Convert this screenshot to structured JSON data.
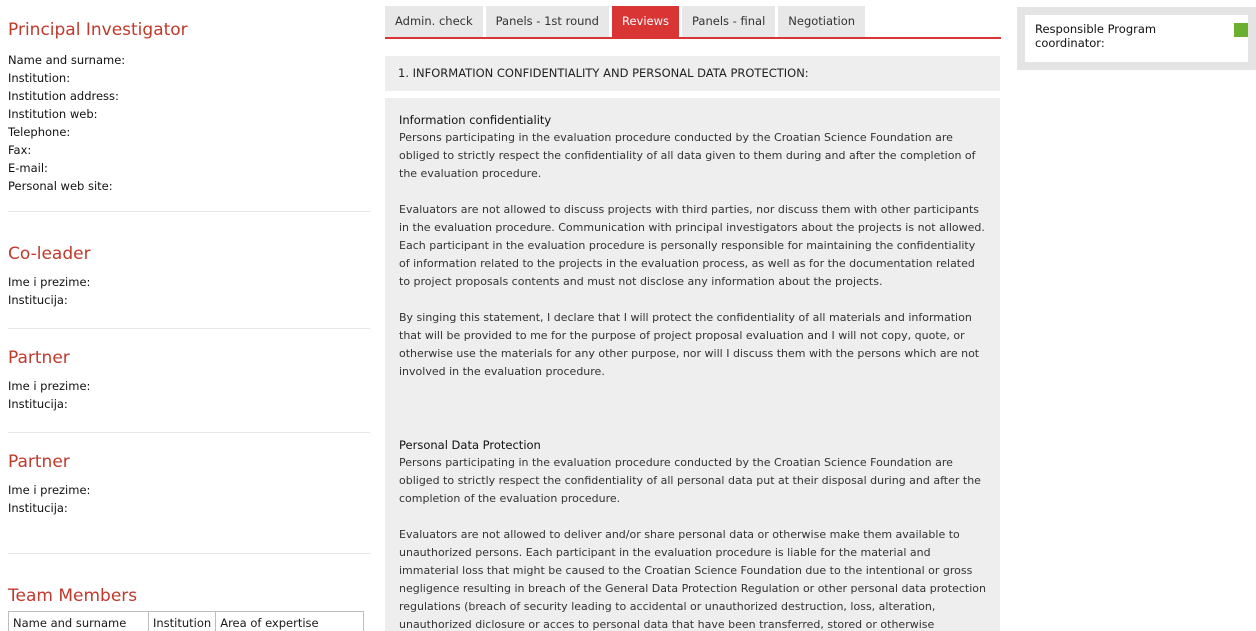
{
  "principal_investigator": {
    "title": "Principal Investigator",
    "fields": [
      "Name and surname:",
      "Institution:",
      "Institution address:",
      "Institution web:",
      "Telephone:",
      "Fax:",
      "E-mail:",
      "Personal web site:"
    ]
  },
  "co_leader": {
    "title": "Co-leader",
    "fields": [
      "Ime i prezime:",
      "Institucija:"
    ]
  },
  "partner1": {
    "title": "Partner",
    "fields": [
      "Ime i prezime:",
      "Institucija:"
    ]
  },
  "partner2": {
    "title": "Partner",
    "fields": [
      "Ime i prezime:",
      "Institucija:"
    ]
  },
  "team_members": {
    "title": "Team Members",
    "columns": [
      "Name and surname",
      "Institution",
      "Area of expertise"
    ]
  },
  "tabs": [
    {
      "label": "Admin. check",
      "active": false
    },
    {
      "label": "Panels - 1st round",
      "active": false
    },
    {
      "label": "Reviews",
      "active": true
    },
    {
      "label": "Panels - final",
      "active": false
    },
    {
      "label": "Negotiation",
      "active": false
    }
  ],
  "section": {
    "header": "1. INFORMATION CONFIDENTIALITY AND PERSONAL DATA PROTECTION:",
    "confidentiality": {
      "title": "Information confidentiality",
      "paragraphs": [
        "Persons participating in the evaluation procedure conducted by the Croatian Science Foundation are obliged to strictly respect the confidentiality of all data given to them during and after the completion of the evaluation procedure.",
        "Evaluators are not allowed to discuss projects with third parties, nor discuss them with other participants in the evaluation procedure. Communication with principal investigators about the projects is not allowed. Each participant in the evaluation procedure is personally responsible for maintaining the confidentiality of information related to the projects in the evaluation process, as well as for the documentation related to project proposals contents and must not disclose any information about the projects.",
        "By singing this statement, I declare that I will protect the confidentiality of all materials and information that will be provided to me for the purpose of project proposal evaluation and I will not copy, quote, or otherwise use the materials for any other purpose, nor will I discuss them with the persons which are not involved in the evaluation procedure."
      ]
    },
    "data_protection": {
      "title": "Personal Data Protection",
      "paragraphs": [
        "Persons participating in the evaluation procedure conducted by the Croatian Science Foundation are obliged to strictly respect the confidentiality of all personal data put at their disposal during and after the completion of the evaluation procedure.",
        "Evaluators are not allowed to deliver and/or share personal data or otherwise make them available to unauthorized persons. Each participant in the evaluation procedure is liable for the material and immaterial loss that might be caused to the Croatian Science Foundation due to the intentional or gross negligence resulting in breach of the General Data Protection Regulation or other personal data protection regulations (breach of security leading to accidental or unauthorized destruction, loss, alteration, unauthorized diclosure or acces to personal data that have been transferred, stored or otherwise"
      ]
    }
  },
  "coordinator": {
    "label": "Responsible Program coordinator:",
    "status_color": "#6aaf2f"
  }
}
